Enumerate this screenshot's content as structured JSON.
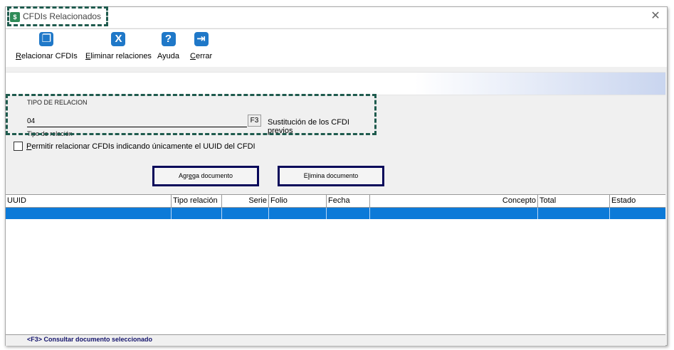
{
  "window": {
    "title": "CFDIs Relacionados",
    "app_icon_glyph": "$",
    "close_glyph": "✕"
  },
  "toolbar": {
    "relacionar": {
      "accel": "R",
      "rest": "elacionar CFDIs",
      "icon": "copy-icon",
      "glyph": "❐"
    },
    "eliminar": {
      "accel": "E",
      "rest": "liminar relaciones",
      "icon": "x-icon",
      "glyph": "X"
    },
    "ayuda": {
      "label": "Ayuda",
      "icon": "question-icon",
      "glyph": "?"
    },
    "cerrar": {
      "accel": "C",
      "rest": "errar",
      "icon": "exit-door-icon",
      "glyph": "⇥"
    }
  },
  "relation": {
    "group_title": "TIPO DE RELACION",
    "value": "04",
    "f3_label": "F3",
    "description": "Sustitución de los CFDI previos",
    "field_label": "Tipo de relación"
  },
  "checkbox": {
    "label_accel": "P",
    "label_rest": "ermitir relacionar CFDIs indicando únicamente el UUID del CFDI",
    "checked": false
  },
  "buttons": {
    "agrega": {
      "pre": "Agr",
      "accel": "e",
      "post": "ga documento"
    },
    "elimina": {
      "pre": "E",
      "accel": "l",
      "post": "imina documento"
    }
  },
  "grid": {
    "columns": [
      "UUID",
      "Tipo relación",
      "Serie",
      "Folio",
      "Fecha",
      "Concepto",
      "Total",
      "Estado"
    ],
    "selected_row_color": "#0c7ad8"
  },
  "footer": {
    "text": "<F3> Consultar documento seleccionado"
  },
  "colors": {
    "accent": "#1f78c8",
    "annotation_dash": "#1f5b4e",
    "button_border": "#07075a"
  }
}
